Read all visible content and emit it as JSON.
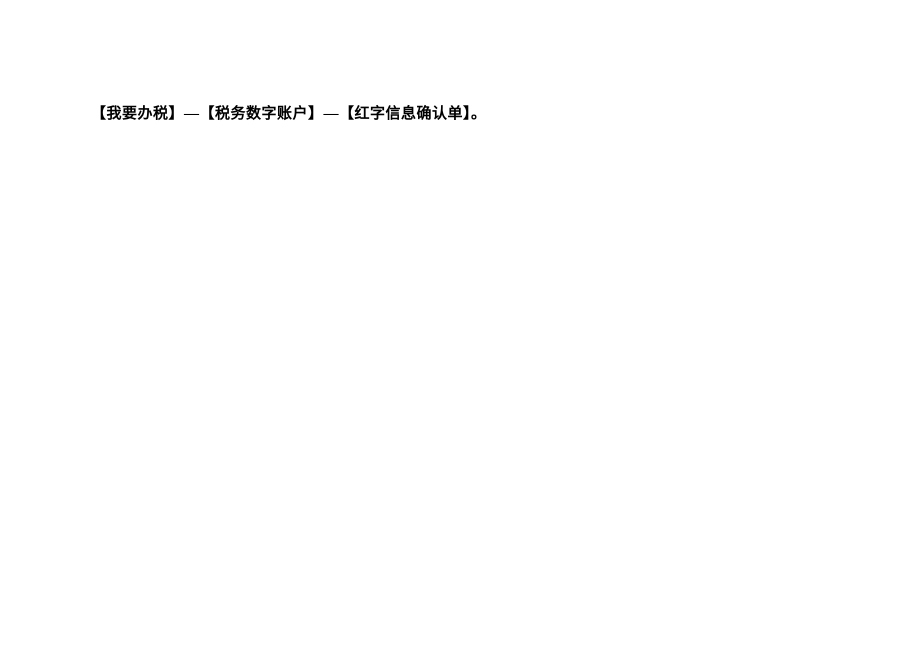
{
  "content": {
    "line1": "【我要办税】—【税务数字账户】—【红字信息确认单】。"
  }
}
